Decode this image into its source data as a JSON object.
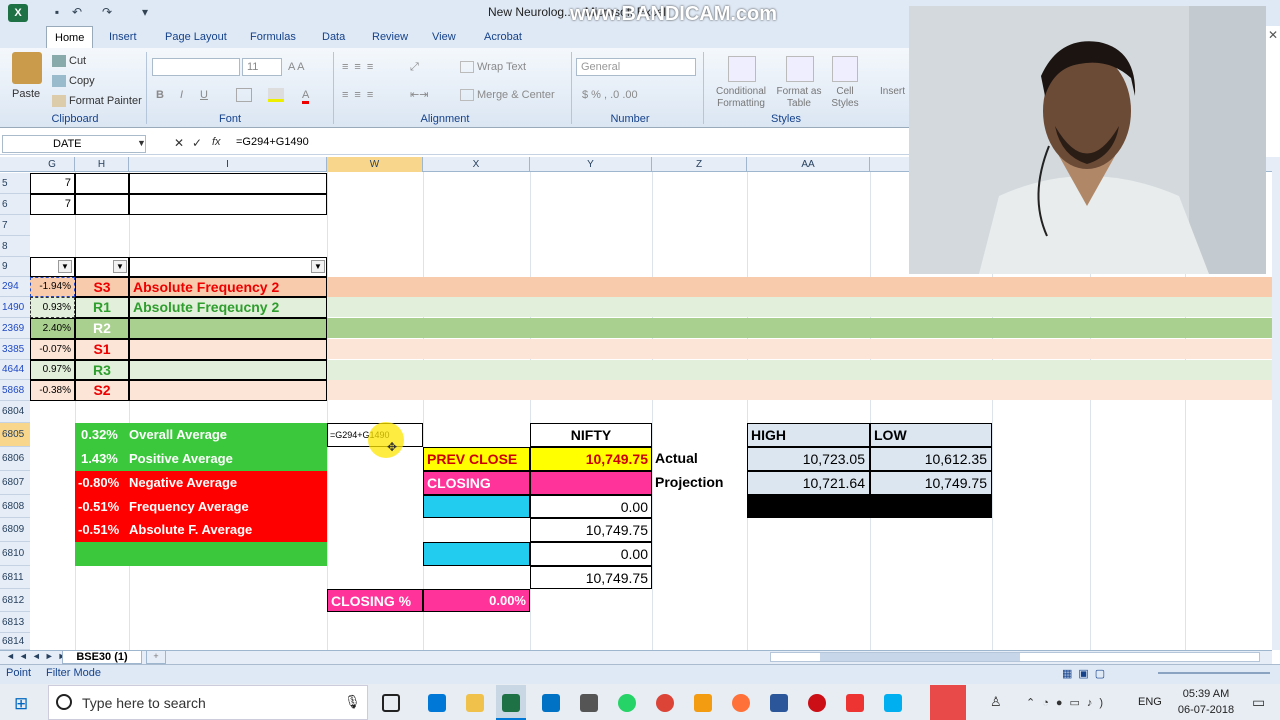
{
  "window": {
    "title": "New Neurolog... - Microsoft Excel",
    "watermark": "www.BANDICAM.com"
  },
  "tabs": [
    "Home",
    "Insert",
    "Page Layout",
    "Formulas",
    "Data",
    "Review",
    "View",
    "Acrobat"
  ],
  "ribbon": {
    "paste": "Paste",
    "cut": "Cut",
    "copy": "Copy",
    "format_painter": "Format Painter",
    "font_size": "11",
    "wrap_text": "Wrap Text",
    "merge_center": "Merge & Center",
    "number_format": "General",
    "conditional_formatting": "Conditional Formatting",
    "format_as_table": "Format as Table",
    "cell_styles": "Cell Styles",
    "insert": "Insert",
    "groups": {
      "clipboard": "Clipboard",
      "font": "Font",
      "alignment": "Alignment",
      "number": "Number",
      "styles": "Styles"
    }
  },
  "formula_bar": {
    "name_box": "DATE",
    "fx": "fx",
    "formula": "=G294+G1490"
  },
  "columns": [
    "G",
    "H",
    "I",
    "W",
    "X",
    "Y",
    "Z",
    "AA"
  ],
  "rows": [
    "5",
    "6",
    "7",
    "8",
    "9",
    "294",
    "1490",
    "2369",
    "3385",
    "4644",
    "5868",
    "6804",
    "6805",
    "6806",
    "6807",
    "6808",
    "6809",
    "6810",
    "6811",
    "6812",
    "6813",
    "6814"
  ],
  "upper": {
    "g5": "7",
    "g6": "7",
    "table": [
      {
        "g": "-1.94%",
        "h": "S3",
        "i": "Absolute Frequency 2"
      },
      {
        "g": "0.93%",
        "h": "R1",
        "i": "Absolute Freqeucny 2"
      },
      {
        "g": "2.40%",
        "h": "R2",
        "i": ""
      },
      {
        "g": "-0.07%",
        "h": "S1",
        "i": ""
      },
      {
        "g": "0.97%",
        "h": "R3",
        "i": ""
      },
      {
        "g": "-0.38%",
        "h": "S2",
        "i": ""
      }
    ]
  },
  "averages": [
    {
      "value": "0.32%",
      "label": "Overall Average"
    },
    {
      "value": "1.43%",
      "label": "Positive Average"
    },
    {
      "value": "-0.80%",
      "label": "Negative Average"
    },
    {
      "value": "-0.51%",
      "label": "Frequency Average"
    },
    {
      "value": "-0.51%",
      "label": "Absolute  F. Average"
    }
  ],
  "editing_cell": "=G294+G1490",
  "nifty": {
    "header": "NIFTY",
    "prev_close_label": "PREV CLOSE",
    "prev_close": "10,749.75",
    "closing_label": "CLOSING",
    "y6808": "0.00",
    "y6809": "10,749.75",
    "y6810": "0.00",
    "y6811": "10,749.75",
    "closing_pct_label": "CLOSING %",
    "closing_pct": "0.00%"
  },
  "hl": {
    "high": "HIGH",
    "low": "LOW",
    "actual_label": "Actual",
    "projection_label": "Projection",
    "actual_high": "10,723.05",
    "actual_low": "10,612.35",
    "proj_high": "10,721.64",
    "proj_low": "10,749.75"
  },
  "sheet_tab": "BSE30  (1)",
  "status": {
    "mode": "Point",
    "filter": "Filter Mode"
  },
  "taskbar": {
    "search": "Type here to search",
    "time": "05:39 AM",
    "date": "06-07-2018",
    "lang": "ENG"
  },
  "colors": {
    "green": "#3cc83c",
    "red": "#ff0000",
    "yellow": "#ffff00",
    "pink": "#ff3399",
    "cyan": "#22ccee",
    "accent": "#1e7145"
  }
}
